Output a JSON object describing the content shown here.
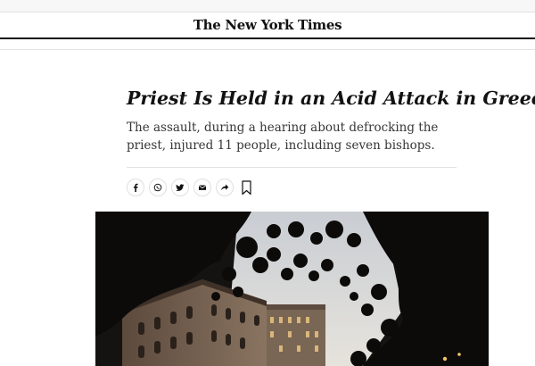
{
  "masthead": {
    "logo": "The New York Times"
  },
  "article": {
    "headline": "Priest Is Held in an Acid Attack in Greece",
    "summary": "The assault, during a hearing about defrocking the priest, injured 11 people, including seven bishops."
  },
  "share": {
    "buttons": [
      {
        "name": "facebook",
        "icon": "facebook-icon"
      },
      {
        "name": "whatsapp",
        "icon": "whatsapp-icon"
      },
      {
        "name": "twitter",
        "icon": "twitter-icon"
      },
      {
        "name": "email",
        "icon": "email-icon"
      },
      {
        "name": "share",
        "icon": "share-arrow-icon"
      }
    ],
    "save_icon": "bookmark-icon"
  },
  "colors": {
    "text": "#121212",
    "summary": "#363636",
    "rule": "#e2e2e2"
  }
}
